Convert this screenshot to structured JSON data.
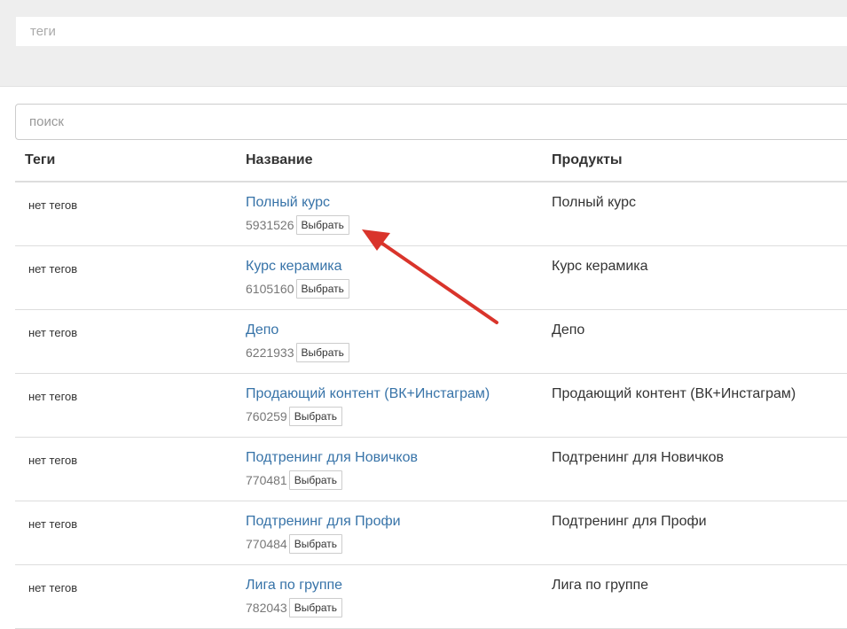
{
  "tags_field": {
    "placeholder": "теги"
  },
  "search_field": {
    "placeholder": "поиск"
  },
  "table": {
    "headers": {
      "tags": "Теги",
      "name": "Название",
      "products": "Продукты"
    },
    "rows": [
      {
        "tags": "нет тегов",
        "name": "Полный курс",
        "id": "5931526",
        "select_label": "Выбрать",
        "products": "Полный курс"
      },
      {
        "tags": "нет тегов",
        "name": "Курс керамика",
        "id": "6105160",
        "select_label": "Выбрать",
        "products": "Курс керамика"
      },
      {
        "tags": "нет тегов",
        "name": "Депо",
        "id": "6221933",
        "select_label": "Выбрать",
        "products": "Депо"
      },
      {
        "tags": "нет тегов",
        "name": "Продающий контент (ВК+Инстаграм)",
        "id": "760259",
        "select_label": "Выбрать",
        "products": "Продающий контент (ВК+Инстаграм)"
      },
      {
        "tags": "нет тегов",
        "name": "Подтренинг для Новичков",
        "id": "770481",
        "select_label": "Выбрать",
        "products": "Подтренинг для Новичков"
      },
      {
        "tags": "нет тегов",
        "name": "Подтренинг для Профи",
        "id": "770484",
        "select_label": "Выбрать",
        "products": "Подтренинг для Профи"
      },
      {
        "tags": "нет тегов",
        "name": "Лига по группе",
        "id": "782043",
        "select_label": "Выбрать",
        "products": "Лига по группе"
      }
    ]
  },
  "colors": {
    "link": "#3773a8",
    "annotation_arrow": "#d9342b",
    "top_band": "#eeeeee"
  },
  "icons": {
    "annotation": "red-arrow-icon"
  }
}
